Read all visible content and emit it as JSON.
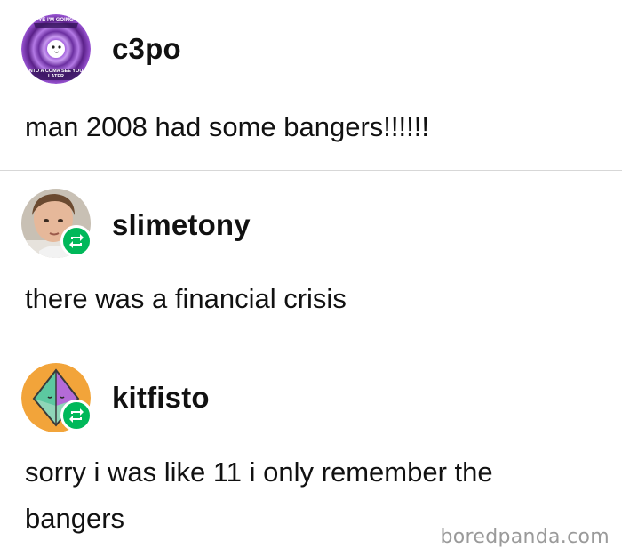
{
  "posts": [
    {
      "username": "c3po",
      "text": "man 2008 had some bangers!!!!!!",
      "avatar": {
        "icon": "spiral-avatar-icon",
        "caption_top": "YE I'M GOING",
        "caption_bottom": "NTO A COMA SEE YOU LATER",
        "colors": [
          "#6b2fa0",
          "#a45cd6",
          "#ffffff"
        ]
      },
      "reblog": false
    },
    {
      "username": "slimetony",
      "text": "there was a financial crisis",
      "avatar": {
        "icon": "boy-photo-avatar"
      },
      "reblog": true
    },
    {
      "username": "kitfisto",
      "text_line1": "sorry i was like 11 i only remember the",
      "text_line2": "bangers",
      "avatar": {
        "icon": "crystal-avatar-icon",
        "colors": [
          "#f2a43a",
          "#5cc8a0",
          "#b46bd8"
        ]
      },
      "reblog": true
    }
  ],
  "watermark": "boredpanda.com",
  "colors": {
    "reblog_green": "#00b85a",
    "divider": "#d7d7d7"
  }
}
